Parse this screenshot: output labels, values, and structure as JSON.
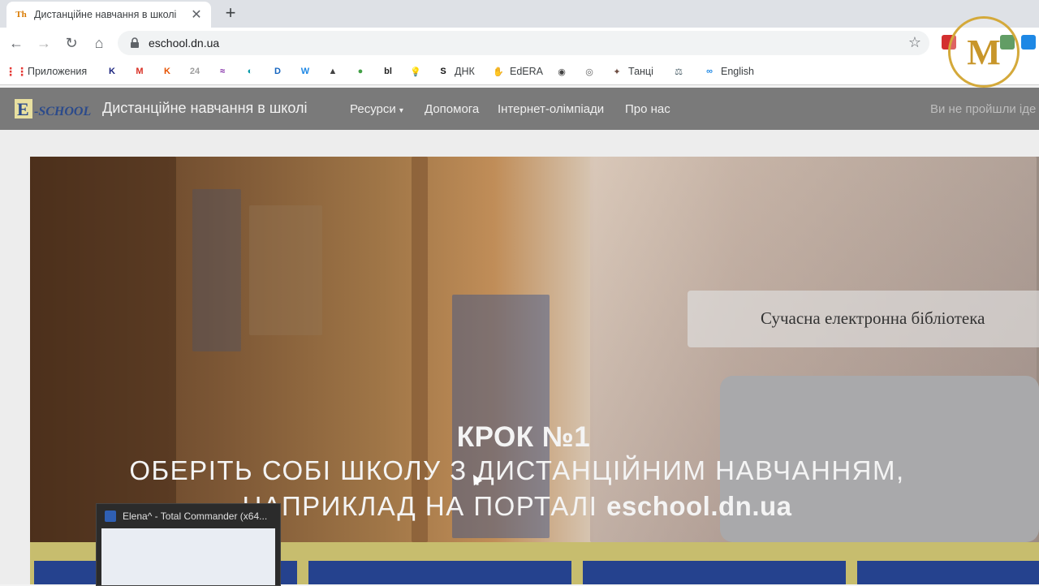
{
  "browser": {
    "tab_title": "Дистанційне навчання в школі",
    "tab_favicon": "Th",
    "url": "eschool.dn.ua"
  },
  "bookmarks": {
    "apps_label": "Приложения",
    "items": [
      {
        "icon": "K",
        "label": ""
      },
      {
        "icon": "M",
        "label": ""
      },
      {
        "icon": "K",
        "label": ""
      },
      {
        "icon": "24",
        "label": ""
      },
      {
        "icon": "≈",
        "label": ""
      },
      {
        "icon": "◐",
        "label": ""
      },
      {
        "icon": "D",
        "label": ""
      },
      {
        "icon": "W",
        "label": ""
      },
      {
        "icon": "▲",
        "label": ""
      },
      {
        "icon": "●",
        "label": ""
      },
      {
        "icon": "bl",
        "label": ""
      },
      {
        "icon": "💡",
        "label": ""
      },
      {
        "icon": "S",
        "label": "ДНК"
      },
      {
        "icon": "✋",
        "label": "EdERA"
      },
      {
        "icon": "◉",
        "label": ""
      },
      {
        "icon": "◎",
        "label": ""
      },
      {
        "icon": "✦",
        "label": "Танці"
      },
      {
        "icon": "⚖",
        "label": ""
      },
      {
        "icon": "∞",
        "label": "English"
      }
    ]
  },
  "site": {
    "logo_text": "E-SCHOOL",
    "title": "Дистанційне навчання в школі",
    "nav": [
      "Ресурси",
      "Допомога",
      "Інтернет-олімпіади",
      "Про нас"
    ],
    "nav_right": "Ви не пройшли іде"
  },
  "hero": {
    "caption": "Сучасна електронна бібліотека",
    "step_title": "КРОК №1",
    "line1": "ОБЕРІТЬ СОБІ ШКОЛУ З ДИСТАНЦІЙНИМ НАВЧАННЯМ,",
    "line2_prefix": "НАПРИКЛАД НА ПОРТАЛІ",
    "line2_site": "eschool.dn.ua"
  },
  "taskbar_preview": {
    "title": "Elena^ - Total Commander (x64..."
  },
  "badge": {
    "letter": "M"
  },
  "colors": {
    "nav_bg": "#7a7a7a",
    "tile_blue": "#25428e",
    "band_yellow": "#c7bd6e",
    "badge_gold": "#d4a93a"
  }
}
